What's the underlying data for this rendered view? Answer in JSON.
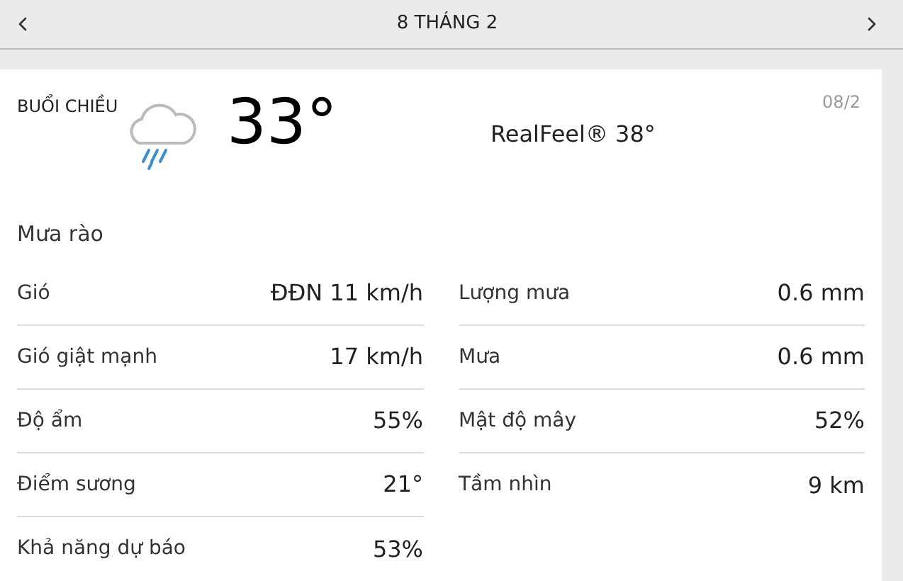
{
  "header": {
    "title": "8 THÁNG 2"
  },
  "card": {
    "period": "BUỔI CHIỀU",
    "temperature": "33°",
    "realfeel": "RealFeel® 38°",
    "date": "08/2",
    "phrase": "Mưa rào"
  },
  "left_details": [
    {
      "label": "Gió",
      "value": "ĐĐN 11 km/h"
    },
    {
      "label": "Gió giật mạnh",
      "value": "17 km/h"
    },
    {
      "label": "Độ ẩm",
      "value": "55%"
    },
    {
      "label": "Điểm sương",
      "value": "21°"
    },
    {
      "label": "Khả năng dự báo",
      "value": "53%"
    }
  ],
  "right_details": [
    {
      "label": "Lượng mưa",
      "value": "0.6 mm"
    },
    {
      "label": "Mưa",
      "value": "0.6 mm"
    },
    {
      "label": "Mật độ mây",
      "value": "52%"
    },
    {
      "label": "Tầm nhìn",
      "value": "9 km"
    }
  ]
}
